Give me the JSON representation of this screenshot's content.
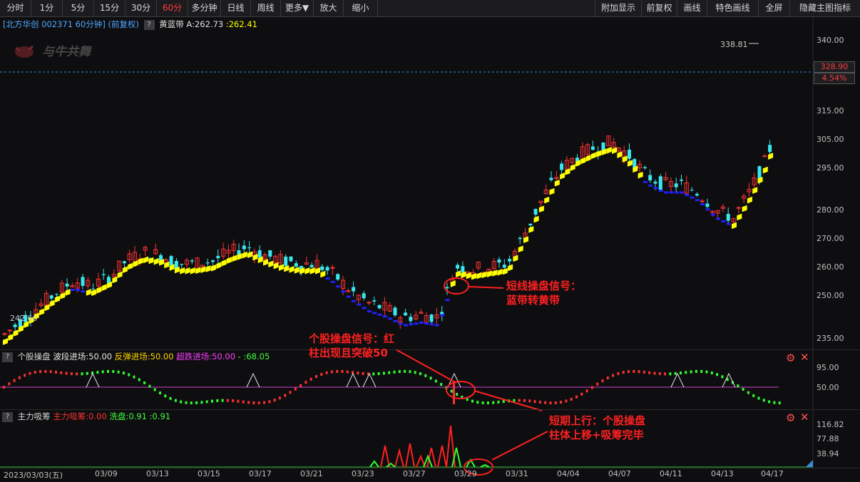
{
  "toolbar": {
    "left": [
      "分时",
      "1分",
      "5分",
      "15分",
      "30分",
      "60分",
      "多分钟",
      "日线",
      "周线",
      "更多▼",
      "放大",
      "缩小"
    ],
    "active": "60分",
    "right": [
      "附加显示",
      "前复权",
      "画线",
      "特色画线",
      "全屏",
      "隐藏主图指标"
    ]
  },
  "info": {
    "stock": "[北方华创 002371 60分钟] (前复权)",
    "indicator": "黄蓝带",
    "a_label": "A:262.73",
    "b_label": ":262.41",
    "q": "?"
  },
  "logo_text": "与牛共舞",
  "price_axis": {
    "labels": [
      "340.00",
      "328.90",
      "315.00",
      "305.00",
      "295.00",
      "280.00",
      "270.00",
      "260.00",
      "250.00",
      "235.00"
    ],
    "current": "328.90",
    "pct": "4.54%",
    "high_note": "338.81",
    "low_note": "242.60"
  },
  "panel2": {
    "title": "个股操盘",
    "items": [
      {
        "label": "波段进场:50.00",
        "color": "#e6e6e6"
      },
      {
        "label": "反弹进场:50.00",
        "color": "#ffd400"
      },
      {
        "label": "超跌进场:50.00",
        "color": "#ff3cff"
      },
      {
        "label": "- :68.05",
        "color": "#40ff40"
      }
    ],
    "axis": [
      "95.00",
      "50.00"
    ]
  },
  "panel3": {
    "title": "主力吸筹",
    "items": [
      {
        "label": "主力吸筹:0.00",
        "color": "#ff3030"
      },
      {
        "label": "洗盘:0.91",
        "color": "#40ff40"
      },
      {
        "label": ":0.91",
        "color": "#40ff40"
      }
    ],
    "axis": [
      "116.82",
      "77.88",
      "38.94"
    ]
  },
  "dates": [
    "2023/03/03(五)",
    "03/09",
    "03/13",
    "03/15",
    "03/17",
    "03/21",
    "03/23",
    "03/27",
    "03/29",
    "03/31",
    "04/04",
    "04/07",
    "04/11",
    "04/13",
    "04/17"
  ],
  "annotations": {
    "a1": [
      "短线操盘信号：",
      "蓝带转黄带"
    ],
    "a2": [
      "个股操盘信号：红",
      "柱出现且突破50"
    ],
    "a3": [
      "短期上行：个股操盘",
      "柱体上移+吸筹完毕"
    ]
  },
  "colors": {
    "up": "#ff3232",
    "down": "#3ae6f0",
    "yellow_band": "#ffff00",
    "blue_band": "#2020ff",
    "annotation": "#ff2020"
  },
  "icons": [
    "gear-icon",
    "close-icon"
  ]
}
